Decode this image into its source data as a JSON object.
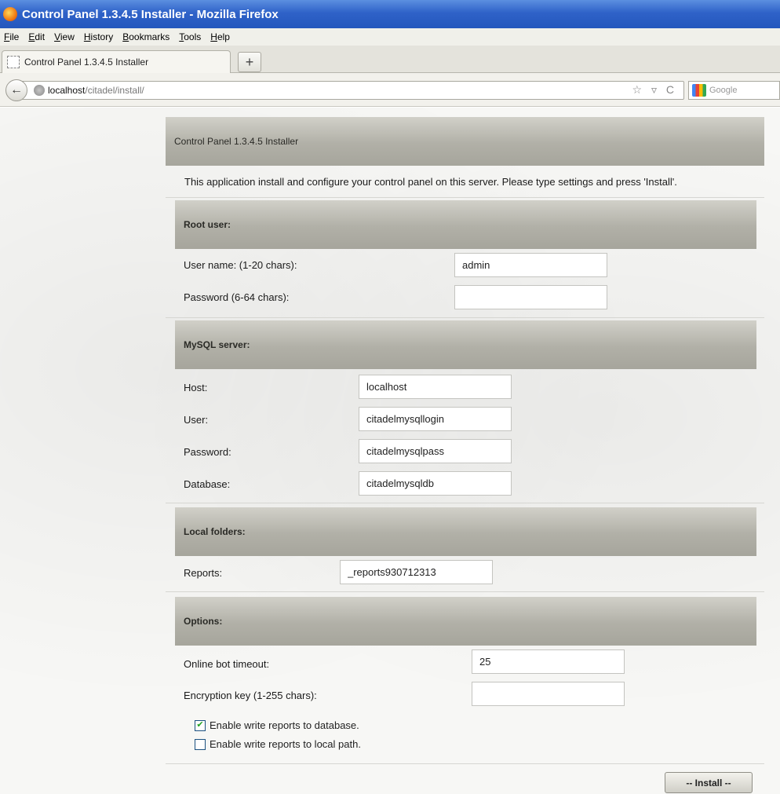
{
  "window": {
    "title": "Control Panel 1.3.4.5 Installer - Mozilla Firefox"
  },
  "menu": [
    "File",
    "Edit",
    "View",
    "History",
    "Bookmarks",
    "Tools",
    "Help"
  ],
  "tab": {
    "title": "Control Panel 1.3.4.5 Installer",
    "new_tab_label": "+"
  },
  "navbar": {
    "url_host": "localhost",
    "url_path": "/citadel/install/",
    "url_icons": "☆ ▿ C",
    "search_placeholder": "Google"
  },
  "page": {
    "header": "Control Panel 1.3.4.5 Installer",
    "intro": "This application install and configure your control panel on this server. Please type settings and press 'Install'.",
    "root_user": {
      "title": "Root user:",
      "username_label": "User name: (1-20 chars):",
      "username_value": "admin",
      "password_label": "Password (6-64 chars):",
      "password_value": ""
    },
    "mysql": {
      "title": "MySQL server:",
      "host_label": "Host:",
      "host_value": "localhost",
      "user_label": "User:",
      "user_value": "citadelmysqllogin",
      "password_label": "Password:",
      "password_value": "citadelmysqlpass",
      "database_label": "Database:",
      "database_value": "citadelmysqldb"
    },
    "local_folders": {
      "title": "Local folders:",
      "reports_label": "Reports:",
      "reports_value": "_reports930712313"
    },
    "options": {
      "title": "Options:",
      "timeout_label": "Online bot timeout:",
      "timeout_value": "25",
      "encryption_label": "Encryption key (1-255 chars):",
      "encryption_value": "",
      "write_db_label": "Enable write reports to database.",
      "write_db_checked": true,
      "write_local_label": "Enable write reports to local path.",
      "write_local_checked": false
    },
    "install_label": "-- Install --"
  }
}
